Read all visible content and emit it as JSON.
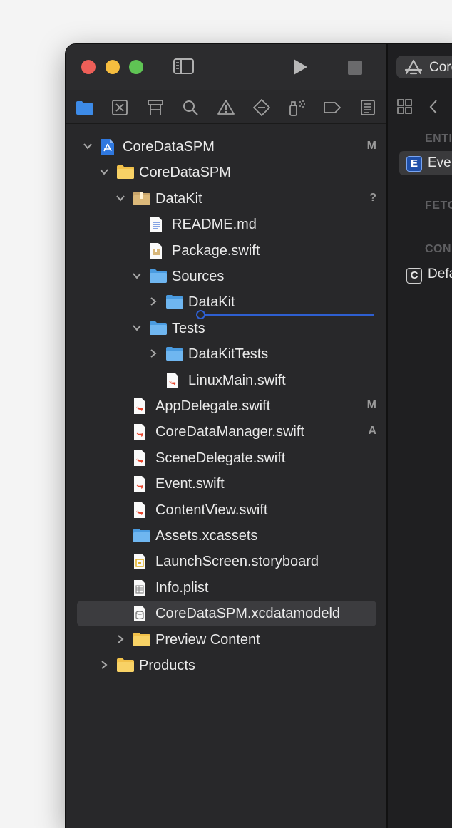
{
  "toolbar": {
    "run_icon": "play-icon",
    "stop_icon": "stop-icon",
    "sidebar_toggle_icon": "sidebar-toggle-icon",
    "scheme_label": "Core"
  },
  "navigator_tabs": [
    {
      "name": "project-navigator",
      "icon": "folder-icon"
    },
    {
      "name": "source-control-navigator",
      "icon": "source-control-icon"
    },
    {
      "name": "symbol-navigator",
      "icon": "hierarchy-icon"
    },
    {
      "name": "find-navigator",
      "icon": "search-icon"
    },
    {
      "name": "issue-navigator",
      "icon": "warning-icon"
    },
    {
      "name": "test-navigator",
      "icon": "test-diamond-icon"
    },
    {
      "name": "debug-navigator",
      "icon": "spray-icon"
    },
    {
      "name": "breakpoint-navigator",
      "icon": "breakpoint-icon"
    },
    {
      "name": "report-navigator",
      "icon": "report-icon"
    }
  ],
  "tree": [
    {
      "label": "CoreDataSPM",
      "icon": "project",
      "depth": 0,
      "chevron": "down",
      "badge": "M"
    },
    {
      "label": "CoreDataSPM",
      "icon": "folder-yellow",
      "depth": 1,
      "chevron": "down",
      "badge": ""
    },
    {
      "label": "DataKit",
      "icon": "package",
      "depth": 2,
      "chevron": "down",
      "badge": "?"
    },
    {
      "label": "README.md",
      "icon": "doc",
      "depth": 3,
      "chevron": "",
      "badge": ""
    },
    {
      "label": "Package.swift",
      "icon": "package-file",
      "depth": 3,
      "chevron": "",
      "badge": ""
    },
    {
      "label": "Sources",
      "icon": "folder-blue",
      "depth": 3,
      "chevron": "down",
      "badge": ""
    },
    {
      "label": "DataKit",
      "icon": "folder-blue",
      "depth": 4,
      "chevron": "right",
      "badge": ""
    },
    {
      "label": "Tests",
      "icon": "folder-blue",
      "depth": 3,
      "chevron": "down",
      "badge": ""
    },
    {
      "label": "DataKitTests",
      "icon": "folder-blue",
      "depth": 4,
      "chevron": "right",
      "badge": ""
    },
    {
      "label": "LinuxMain.swift",
      "icon": "swift",
      "depth": 4,
      "chevron": "",
      "badge": ""
    },
    {
      "label": "AppDelegate.swift",
      "icon": "swift",
      "depth": 2,
      "chevron": "",
      "badge": "M"
    },
    {
      "label": "CoreDataManager.swift",
      "icon": "swift",
      "depth": 2,
      "chevron": "",
      "badge": "A"
    },
    {
      "label": "SceneDelegate.swift",
      "icon": "swift",
      "depth": 2,
      "chevron": "",
      "badge": ""
    },
    {
      "label": "Event.swift",
      "icon": "swift",
      "depth": 2,
      "chevron": "",
      "badge": ""
    },
    {
      "label": "ContentView.swift",
      "icon": "swift",
      "depth": 2,
      "chevron": "",
      "badge": ""
    },
    {
      "label": "Assets.xcassets",
      "icon": "folder-blue",
      "depth": 2,
      "chevron": "",
      "badge": ""
    },
    {
      "label": "LaunchScreen.storyboard",
      "icon": "storyboard",
      "depth": 2,
      "chevron": "",
      "badge": ""
    },
    {
      "label": "Info.plist",
      "icon": "plist",
      "depth": 2,
      "chevron": "",
      "badge": ""
    },
    {
      "label": "CoreDataSPM.xcdatamodeld",
      "icon": "datamodel",
      "depth": 2,
      "chevron": "",
      "badge": "",
      "selected": true
    },
    {
      "label": "Preview Content",
      "icon": "folder-yellow",
      "depth": 2,
      "chevron": "right",
      "badge": ""
    },
    {
      "label": "Products",
      "icon": "folder-yellow",
      "depth": 1,
      "chevron": "right",
      "badge": ""
    }
  ],
  "editor": {
    "section_entities": "ENTI",
    "entity_letter": "E",
    "entity_label": "Eve",
    "section_fetch": "FETC",
    "section_config": "CON",
    "config_letter": "C",
    "config_label": "Defa"
  },
  "colors": {
    "close": "#ee5f58",
    "minimize": "#f6bd3f",
    "zoom": "#5fc454",
    "accent": "#3d8be8",
    "selection": "#3c3c3f"
  }
}
